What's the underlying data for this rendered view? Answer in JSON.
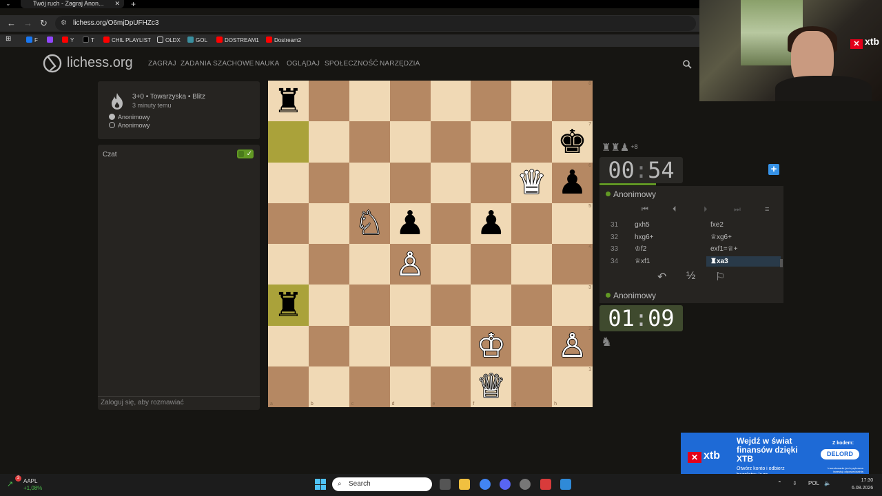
{
  "browser": {
    "tab_title": "Twój ruch - Zagraj Anon...",
    "url": "lichess.org/O6mjDpUFHZc3",
    "bookmarks": [
      "F",
      "",
      "Y",
      "T",
      "CHIL PLAYLIST",
      "OLDX",
      "GOL",
      "DOSTREAM1",
      "Dostream2"
    ]
  },
  "site": {
    "name": "lichess.org",
    "nav": [
      "ZAGRAJ",
      "ZADANIA SZACHOWE",
      "NAUKA",
      "OGLĄDAJ",
      "SPOŁECZNOŚĆ",
      "NARZĘDZIA"
    ]
  },
  "game_info": {
    "mode": "3+0 • Towarzyska • Blitz",
    "time_ago": "3 minuty temu",
    "white_player": "Anonimowy",
    "black_player": "Anonimowy"
  },
  "chat": {
    "label": "Czat",
    "toggle_on": true,
    "placeholder": "Zaloguj się, aby rozmawiać"
  },
  "board": {
    "files": [
      "a",
      "b",
      "c",
      "d",
      "e",
      "f",
      "g",
      "h"
    ],
    "ranks": [
      "8",
      "7",
      "6",
      "5",
      "4",
      "3",
      "2",
      "1"
    ],
    "squares": [
      [
        "♜",
        "",
        "",
        "",
        "",
        "",
        "",
        ""
      ],
      [
        "",
        "",
        "",
        "",
        "",
        "",
        "",
        "♚"
      ],
      [
        "",
        "",
        "",
        "",
        "",
        "",
        "♛",
        "♟"
      ],
      [
        "",
        "",
        "♘",
        "♟",
        "",
        "♟",
        "",
        ""
      ],
      [
        "",
        "",
        "",
        "♙",
        "",
        "",
        "",
        ""
      ],
      [
        "♜",
        "",
        "",
        "",
        "",
        "",
        "",
        ""
      ],
      [
        "",
        "",
        "",
        "",
        "",
        "♔",
        "",
        "♙"
      ],
      [
        "",
        "",
        "",
        "",
        "",
        "♕",
        "",
        ""
      ]
    ],
    "colors": [
      [
        "b",
        "",
        "",
        "",
        "",
        "",
        "",
        ""
      ],
      [
        "",
        "",
        "",
        "",
        "",
        "",
        "",
        "b"
      ],
      [
        "",
        "",
        "",
        "",
        "",
        "",
        "w",
        "b"
      ],
      [
        "",
        "",
        "w",
        "b",
        "",
        "b",
        "",
        ""
      ],
      [
        "",
        "",
        "",
        "w",
        "",
        "",
        "",
        ""
      ],
      [
        "b",
        "",
        "",
        "",
        "",
        "",
        "",
        ""
      ],
      [
        "",
        "",
        "",
        "",
        "",
        "w",
        "",
        "w"
      ],
      [
        "",
        "",
        "",
        "",
        "",
        "w",
        "",
        ""
      ]
    ],
    "highlight": [
      "a7",
      "a3"
    ]
  },
  "opponent": {
    "captured": "♜♜♟",
    "advantage": "+8",
    "clock_min": "00",
    "clock_sec": "54",
    "name": "Anonimowy"
  },
  "player": {
    "name": "Anonimowy",
    "clock_min": "01",
    "clock_sec": "09"
  },
  "moves": [
    {
      "num": "31",
      "white": "gxh5",
      "black": "fxe2"
    },
    {
      "num": "32",
      "white": "hxg6+",
      "black": "♕xg6+"
    },
    {
      "num": "33",
      "white": "♔f2",
      "black": "exf1=♕+"
    },
    {
      "num": "34",
      "white": "♕xf1",
      "black": "♜xa3"
    }
  ],
  "nav_icons": [
    "first-icon",
    "prev-icon",
    "next-icon",
    "last-icon",
    "menu-icon"
  ],
  "actions": {
    "takeback": "↶",
    "draw": "½",
    "resign": "⚐"
  },
  "ad": {
    "headline": "Wejdź w świat finansów dzięki XTB",
    "sub": "Otwórz konto i odbierz bezpłatny kurs",
    "code_label": "Z kodem:",
    "code": "DELORD",
    "brand": "xtb",
    "fine": "Inwestowanie jest ryzykowne. Inwestuj odpowiedzialnie."
  },
  "webcam_brand": "xtb",
  "taskbar": {
    "stock_symbol": "AAPL",
    "stock_change": "+1,08%",
    "stock_badge": "3",
    "search_placeholder": "Search",
    "lang": "POL",
    "time": "17:30",
    "date": "6.08.2026"
  }
}
